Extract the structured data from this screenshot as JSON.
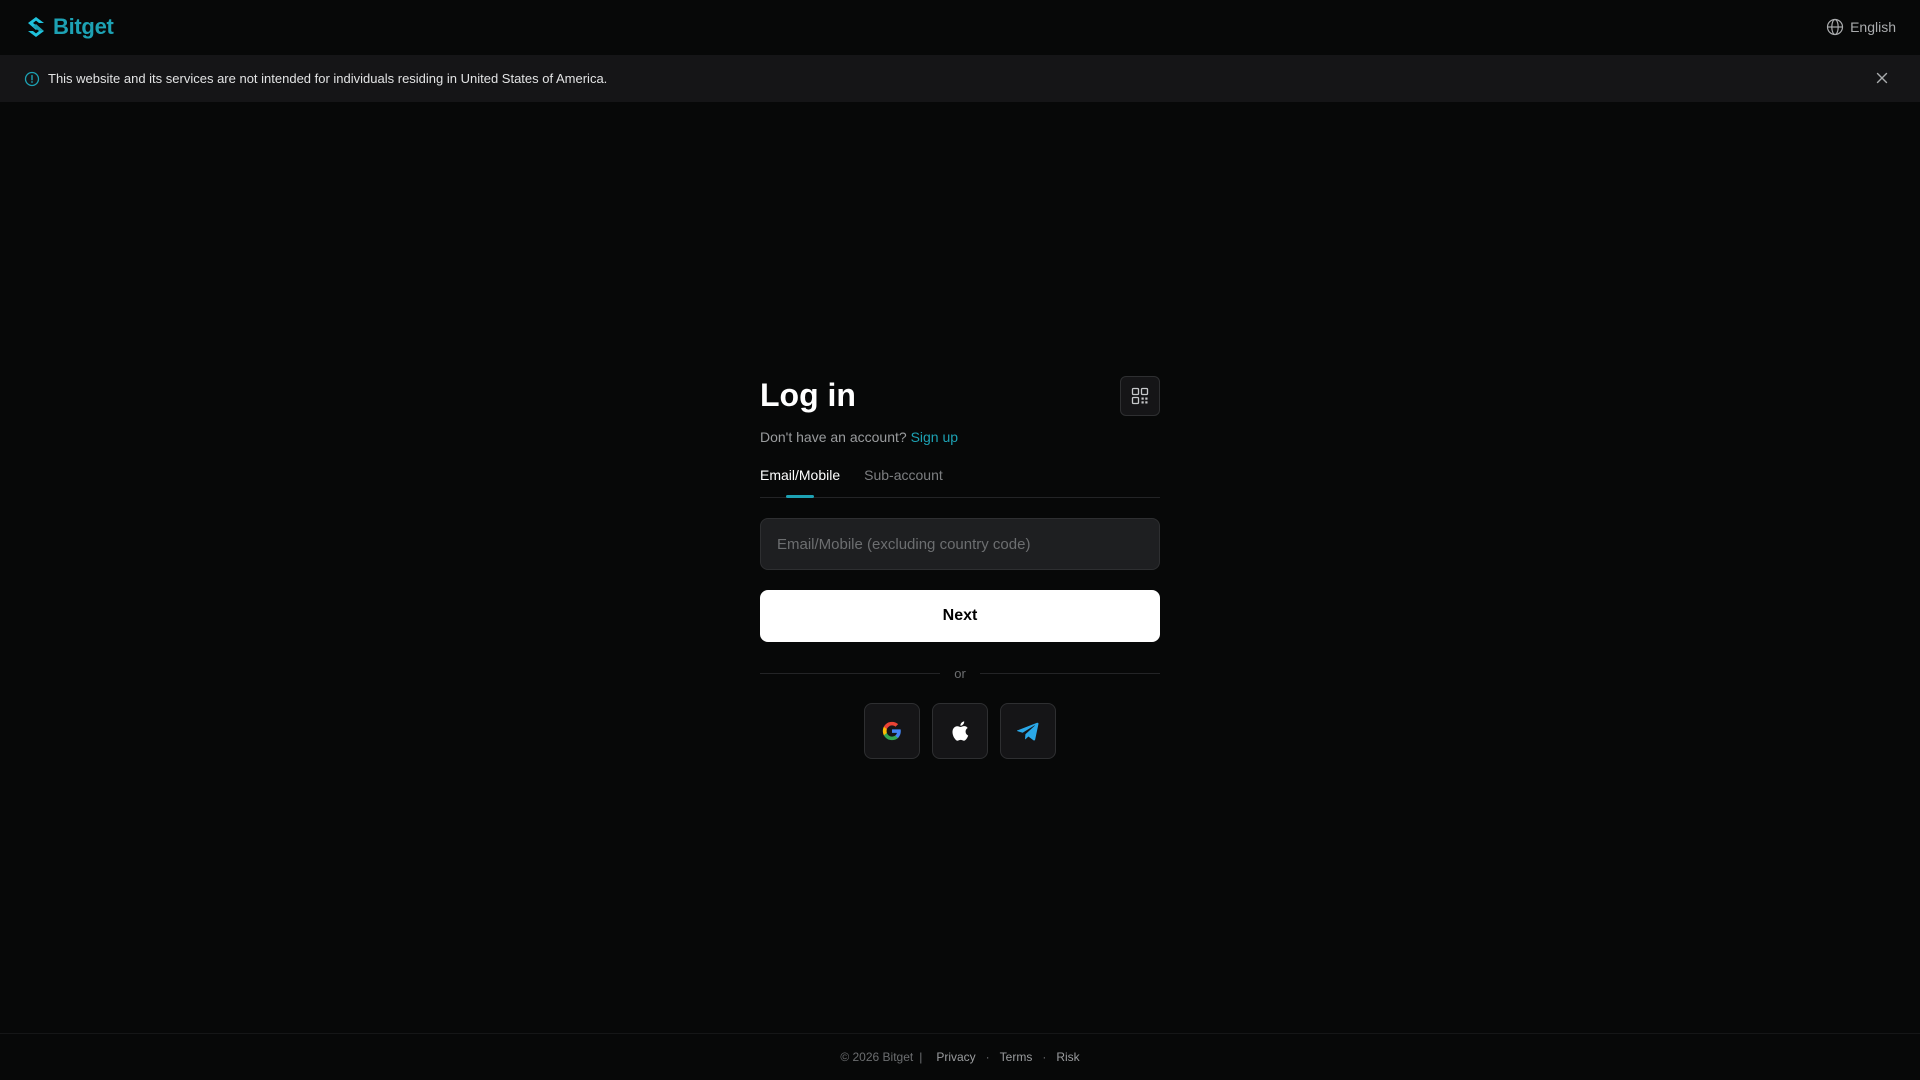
{
  "header": {
    "brand": "Bitget",
    "language": "English"
  },
  "notice": {
    "text": "This website and its services are not intended for individuals residing in United States of America."
  },
  "login": {
    "title": "Log in",
    "no_account_text": "Don't have an account?",
    "signup_link": "Sign up",
    "tabs": [
      {
        "label": "Email/Mobile",
        "active": true
      },
      {
        "label": "Sub-account",
        "active": false
      }
    ],
    "input_placeholder": "Email/Mobile (excluding country code)",
    "next_button": "Next",
    "divider_text": "or",
    "social_icons": [
      "google-icon",
      "apple-icon",
      "telegram-icon"
    ]
  },
  "footer": {
    "copyright": "© 2026 Bitget",
    "separator": "|",
    "links": [
      "Privacy",
      "Terms",
      "Risk"
    ],
    "dot": "·"
  },
  "colors": {
    "background": "#070808",
    "accent": "#1da2b4",
    "panel": "#151517",
    "input_bg": "#1e1f21",
    "button_bg": "#ffffff"
  }
}
